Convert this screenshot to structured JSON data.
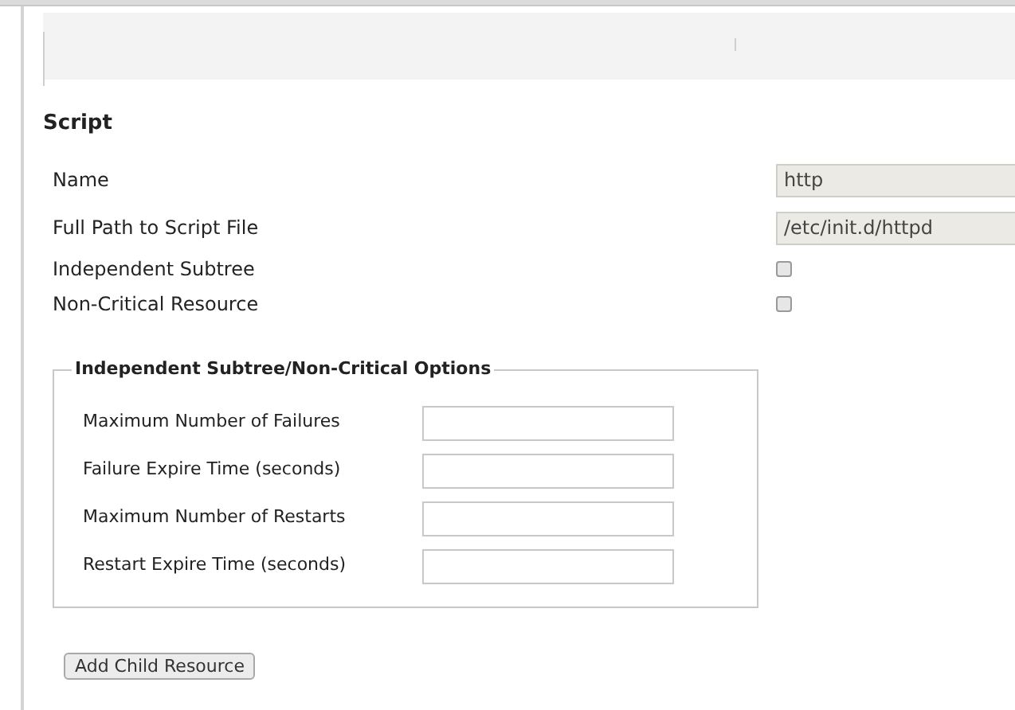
{
  "section_title": "Script",
  "fields": [
    {
      "kind": "text",
      "label": "Name",
      "value": "http"
    },
    {
      "kind": "text",
      "label": "Full Path to Script File",
      "value": "/etc/init.d/httpd"
    },
    {
      "kind": "checkbox",
      "label": "Independent Subtree",
      "checked": false
    },
    {
      "kind": "checkbox",
      "label": "Non-Critical Resource",
      "checked": false
    }
  ],
  "options": {
    "legend": "Independent Subtree/Non-Critical Options",
    "fields": [
      {
        "label": "Maximum Number of Failures"
      },
      {
        "label": "Failure Expire Time (seconds)"
      },
      {
        "label": "Maximum Number of Restarts"
      },
      {
        "label": "Restart Expire Time (seconds)"
      }
    ]
  },
  "button": "Add Child Resource"
}
